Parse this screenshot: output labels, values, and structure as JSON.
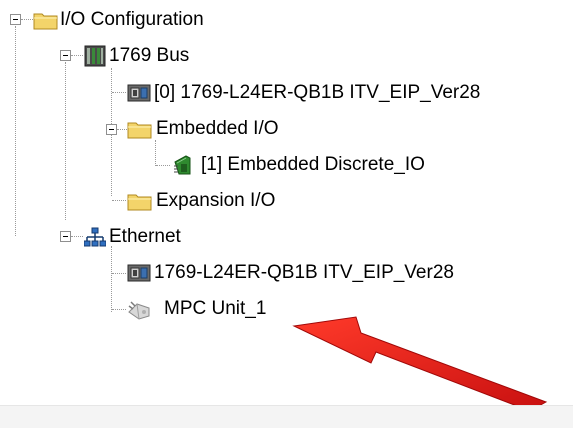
{
  "tree": {
    "io_configuration": "I/O Configuration",
    "bus": "1769 Bus",
    "controller_slot": "[0] 1769-L24ER-QB1B ITV_EIP_Ver28",
    "embedded_io": "Embedded I/O",
    "embedded_discrete": "[1] Embedded Discrete_IO",
    "expansion_io": "Expansion I/O",
    "ethernet": "Ethernet",
    "ethernet_controller": "1769-L24ER-QB1B ITV_EIP_Ver28",
    "mpc_unit": "MPC Unit_1"
  },
  "icons": {
    "folder": "folder-icon",
    "chassis": "chassis-icon",
    "controller": "controller-module-icon",
    "io_card": "io-card-icon",
    "network": "network-icon",
    "device": "generic-device-icon"
  },
  "annotation": {
    "arrow_color": "#e02020"
  },
  "colors": {
    "folder_fill": "#f3d46a",
    "folder_edge": "#b08a20",
    "card_green": "#2f8a2f"
  }
}
